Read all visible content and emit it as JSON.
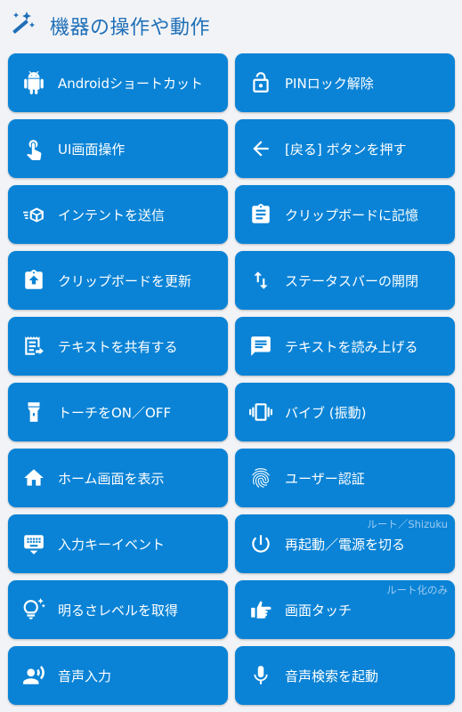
{
  "header": {
    "title": "機器の操作や動作",
    "icon": "magic-wand-icon"
  },
  "colors": {
    "button_bg": "#0a83d6",
    "title": "#1f6fb8",
    "note": "#9ccbf0"
  },
  "items": [
    {
      "label": "Androidショートカット",
      "icon": "android-icon",
      "note": ""
    },
    {
      "label": "PINロック解除",
      "icon": "lock-open-icon",
      "note": ""
    },
    {
      "label": "UI画面操作",
      "icon": "touch-icon",
      "note": ""
    },
    {
      "label": "[戻る] ボタンを押す",
      "icon": "arrow-back-icon",
      "note": ""
    },
    {
      "label": "インテントを送信",
      "icon": "send-intent-icon",
      "note": ""
    },
    {
      "label": "クリップボードに記憶",
      "icon": "clipboard-icon",
      "note": ""
    },
    {
      "label": "クリップボードを更新",
      "icon": "clipboard-upload-icon",
      "note": ""
    },
    {
      "label": "ステータスバーの開閉",
      "icon": "swap-vertical-icon",
      "note": ""
    },
    {
      "label": "テキストを共有する",
      "icon": "receipt-share-icon",
      "note": ""
    },
    {
      "label": "テキストを読み上げる",
      "icon": "message-text-icon",
      "note": ""
    },
    {
      "label": "トーチをON／OFF",
      "icon": "flashlight-icon",
      "note": ""
    },
    {
      "label": "バイブ (振動)",
      "icon": "vibrate-icon",
      "note": ""
    },
    {
      "label": "ホーム画面を表示",
      "icon": "home-icon",
      "note": ""
    },
    {
      "label": "ユーザー認証",
      "icon": "fingerprint-icon",
      "note": ""
    },
    {
      "label": "入力キーイベント",
      "icon": "keyboard-icon",
      "note": ""
    },
    {
      "label": "再起動／電源を切る",
      "icon": "power-icon",
      "note": "ルート／Shizuku"
    },
    {
      "label": "明るさレベルを取得",
      "icon": "lightbulb-icon",
      "note": ""
    },
    {
      "label": "画面タッチ",
      "icon": "hand-point-icon",
      "note": "ルート化のみ"
    },
    {
      "label": "音声入力",
      "icon": "voice-input-icon",
      "note": ""
    },
    {
      "label": "音声検索を起動",
      "icon": "microphone-icon",
      "note": ""
    }
  ]
}
